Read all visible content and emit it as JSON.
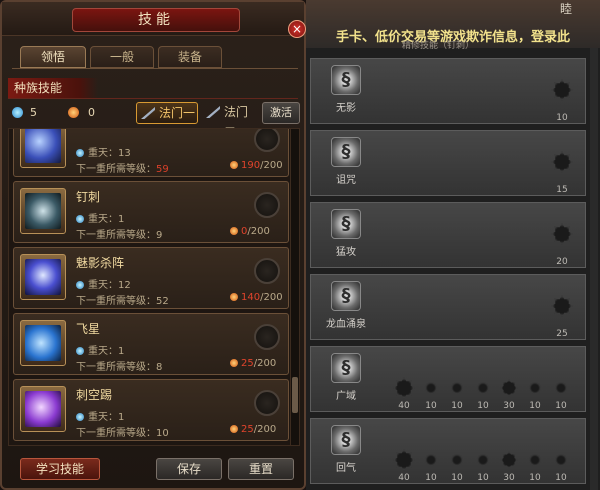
{
  "window": {
    "title": "技能",
    "close_label": "×"
  },
  "tabs": [
    {
      "label": "领悟",
      "active": true
    },
    {
      "label": "一般",
      "active": false
    },
    {
      "label": "装备",
      "active": false
    }
  ],
  "section": {
    "title": "种族技能"
  },
  "resources": {
    "blue_points": "5",
    "fire_points": "0"
  },
  "schools": [
    {
      "label": "法门一",
      "active": true
    },
    {
      "label": "法门二",
      "active": false
    }
  ],
  "activate_label": "激活",
  "skills": [
    {
      "name": "",
      "level_label": "重天：13",
      "next_label": "下一重所需等级：",
      "next_req": "59",
      "req_bad": true,
      "cost_cur": "190",
      "cost_max": "/200",
      "icon": "blade-skill-icon"
    },
    {
      "name": "钉刺",
      "level_label": "重天：1",
      "next_label": "下一重所需等级：",
      "next_req": "9",
      "req_bad": false,
      "cost_cur": "0",
      "cost_max": "/200",
      "icon": "spike-skill-icon"
    },
    {
      "name": "魅影杀阵",
      "level_label": "重天：12",
      "next_label": "下一重所需等级：",
      "next_req": "52",
      "req_bad": false,
      "cost_cur": "140",
      "cost_max": "/200",
      "icon": "phantom-skill-icon"
    },
    {
      "name": "飞星",
      "level_label": "重天：1",
      "next_label": "下一重所需等级：",
      "next_req": "8",
      "req_bad": false,
      "cost_cur": "25",
      "cost_max": "/200",
      "icon": "star-skill-icon"
    },
    {
      "name": "刺空踢",
      "level_label": "重天：1",
      "next_label": "下一重所需等级：",
      "next_req": "10",
      "req_bad": false,
      "cost_cur": "25",
      "cost_max": "/200",
      "icon": "kick-skill-icon"
    }
  ],
  "buttons": {
    "learn": "学习技能",
    "save": "保存",
    "reset": "重置"
  },
  "right": {
    "notice": "手卡、低价交易等游戏欺诈信息，登录此",
    "subnotice": "精修技能（钉刺）",
    "corner": "睦",
    "rows": [
      {
        "name": "无影",
        "nodes": [
          {
            "value": "10"
          }
        ]
      },
      {
        "name": "诅咒",
        "nodes": [
          {
            "value": "15"
          }
        ]
      },
      {
        "name": "猛攻",
        "nodes": [
          {
            "value": "20"
          }
        ]
      },
      {
        "name": "龙血涌泉",
        "nodes": [
          {
            "value": "25"
          }
        ]
      },
      {
        "name": "广域",
        "nodes": [
          {
            "value": "40"
          },
          {
            "value": "10"
          },
          {
            "value": "10"
          },
          {
            "value": "10"
          },
          {
            "value": "30"
          },
          {
            "value": "10"
          },
          {
            "value": "10"
          }
        ]
      },
      {
        "name": "回气",
        "nodes": [
          {
            "value": "40"
          },
          {
            "value": "10"
          },
          {
            "value": "10"
          },
          {
            "value": "10"
          },
          {
            "value": "30"
          },
          {
            "value": "10"
          },
          {
            "value": "10"
          }
        ]
      }
    ]
  },
  "colors": {
    "accent_red": "#7b1510",
    "gold": "#f3c46a",
    "warn_red": "#d8402a"
  }
}
